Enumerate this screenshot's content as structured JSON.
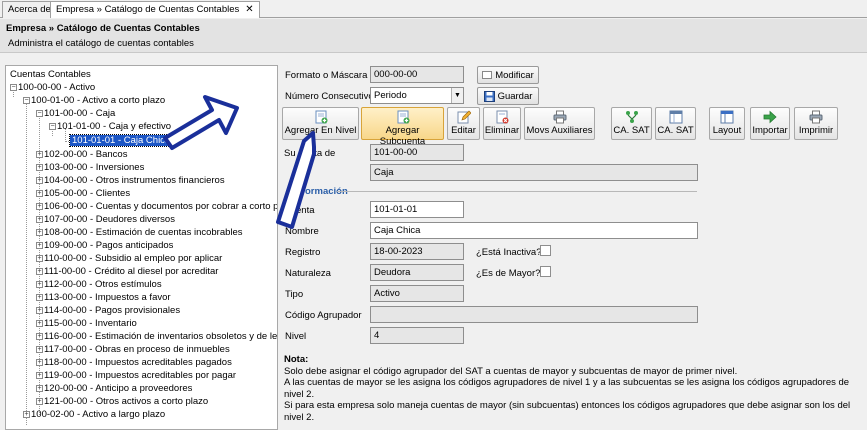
{
  "tabs": [
    {
      "label": "Acerca de"
    },
    {
      "label": "Empresa » Catálogo de Cuentas Contables",
      "close": "✕"
    }
  ],
  "header": {
    "title": "Empresa » Catálogo de Cuentas Contables",
    "subtitle": "Administra el catálogo de cuentas contables"
  },
  "tree": {
    "nodes": [
      {
        "label": "Cuentas Contables"
      },
      {
        "label": "100-00-00 - Activo"
      },
      {
        "label": "100-01-00 - Activo a corto plazo"
      },
      {
        "label": "101-00-00 - Caja"
      },
      {
        "label": "101-01-00 - Caja y efectivo"
      },
      {
        "label": "101-01-01 - Caja Chica",
        "selected": true
      },
      {
        "label": "102-00-00 - Bancos"
      },
      {
        "label": "103-00-00 - Inversiones"
      },
      {
        "label": "104-00-00 - Otros instrumentos financieros"
      },
      {
        "label": "105-00-00 - Clientes"
      },
      {
        "label": "106-00-00 - Cuentas y documentos por cobrar a corto p"
      },
      {
        "label": "107-00-00 - Deudores diversos"
      },
      {
        "label": "108-00-00 - Estimación de cuentas incobrables"
      },
      {
        "label": "109-00-00 - Pagos anticipados"
      },
      {
        "label": "110-00-00 - Subsidio al empleo por aplicar"
      },
      {
        "label": "111-00-00 - Crédito al diesel por acreditar"
      },
      {
        "label": "112-00-00 - Otros estímulos"
      },
      {
        "label": "113-00-00 - Impuestos a favor"
      },
      {
        "label": "114-00-00 - Pagos provisionales"
      },
      {
        "label": "115-00-00 - Inventario"
      },
      {
        "label": "116-00-00 - Estimación de inventarios obsoletos y de le"
      },
      {
        "label": "117-00-00 - Obras en proceso de inmuebles"
      },
      {
        "label": "118-00-00 - Impuestos acreditables pagados"
      },
      {
        "label": "119-00-00 - Impuestos acreditables por pagar"
      },
      {
        "label": "120-00-00 - Anticipo a proveedores"
      },
      {
        "label": "121-00-00 - Otros activos a corto plazo"
      },
      {
        "label": "100-02-00 - Activo a largo plazo"
      }
    ]
  },
  "form": {
    "mask_label": "Formato o Máscara",
    "mask_value": "000-00-00",
    "modify_label": "Modificar",
    "consecutive_label": "Número Consecutivo",
    "consecutive_value": "Periodo",
    "save_label": "Guardar"
  },
  "toolbar": {
    "add_level": "Agregar En Nivel",
    "add_sub": "Agregar Subcuenta",
    "edit": "Editar",
    "delete": "Eliminar",
    "aux": "Movs Auxiliares",
    "ca_sat_1": "CA. SAT",
    "ca_sat_2": "CA. SAT",
    "layout": "Layout",
    "import": "Importar",
    "print": "Imprimir"
  },
  "parent": {
    "label": "Subcuenta de",
    "label_visible": "Su",
    "label_tail": "enta de",
    "code": "101-00-00",
    "name": "Caja"
  },
  "info": {
    "section": "Información",
    "section_visible": "ormación",
    "account_label": "Cuenta",
    "account_visible": "enta",
    "account_value": "101-01-01",
    "name_label": "Nombre",
    "name_value": "Caja Chica",
    "registry_label": "Registro",
    "registry_value": "18-00-2023",
    "inactive_label": "¿Está Inactiva?",
    "nature_label": "Naturaleza",
    "nature_value": "Deudora",
    "major_label": "¿Es de Mayor?",
    "type_label": "Tipo",
    "type_value": "Activo",
    "group_label": "Código Agrupador",
    "group_value": "",
    "level_label": "Nivel",
    "level_value": "4"
  },
  "note": {
    "title": "Nota:",
    "line1": "Solo debe asignar el código agrupador del SAT a cuentas de mayor y subcuentas de mayor de primer nivel.",
    "line2": "A las cuentas de mayor se les asigna los códigos agrupadores de nivel 1 y a las subcuentas se les asigna los códigos agrupadores de nivel 2.",
    "line3": "Si para esta empresa solo maneja cuentas de mayor (sin subcuentas) entonces los códigos agrupadores que debe asignar son los del nivel 2."
  },
  "colors": {
    "accent": "#1c56c6",
    "annotation_arrow": "#1a2f9a",
    "section_title": "#2a5ea8"
  }
}
